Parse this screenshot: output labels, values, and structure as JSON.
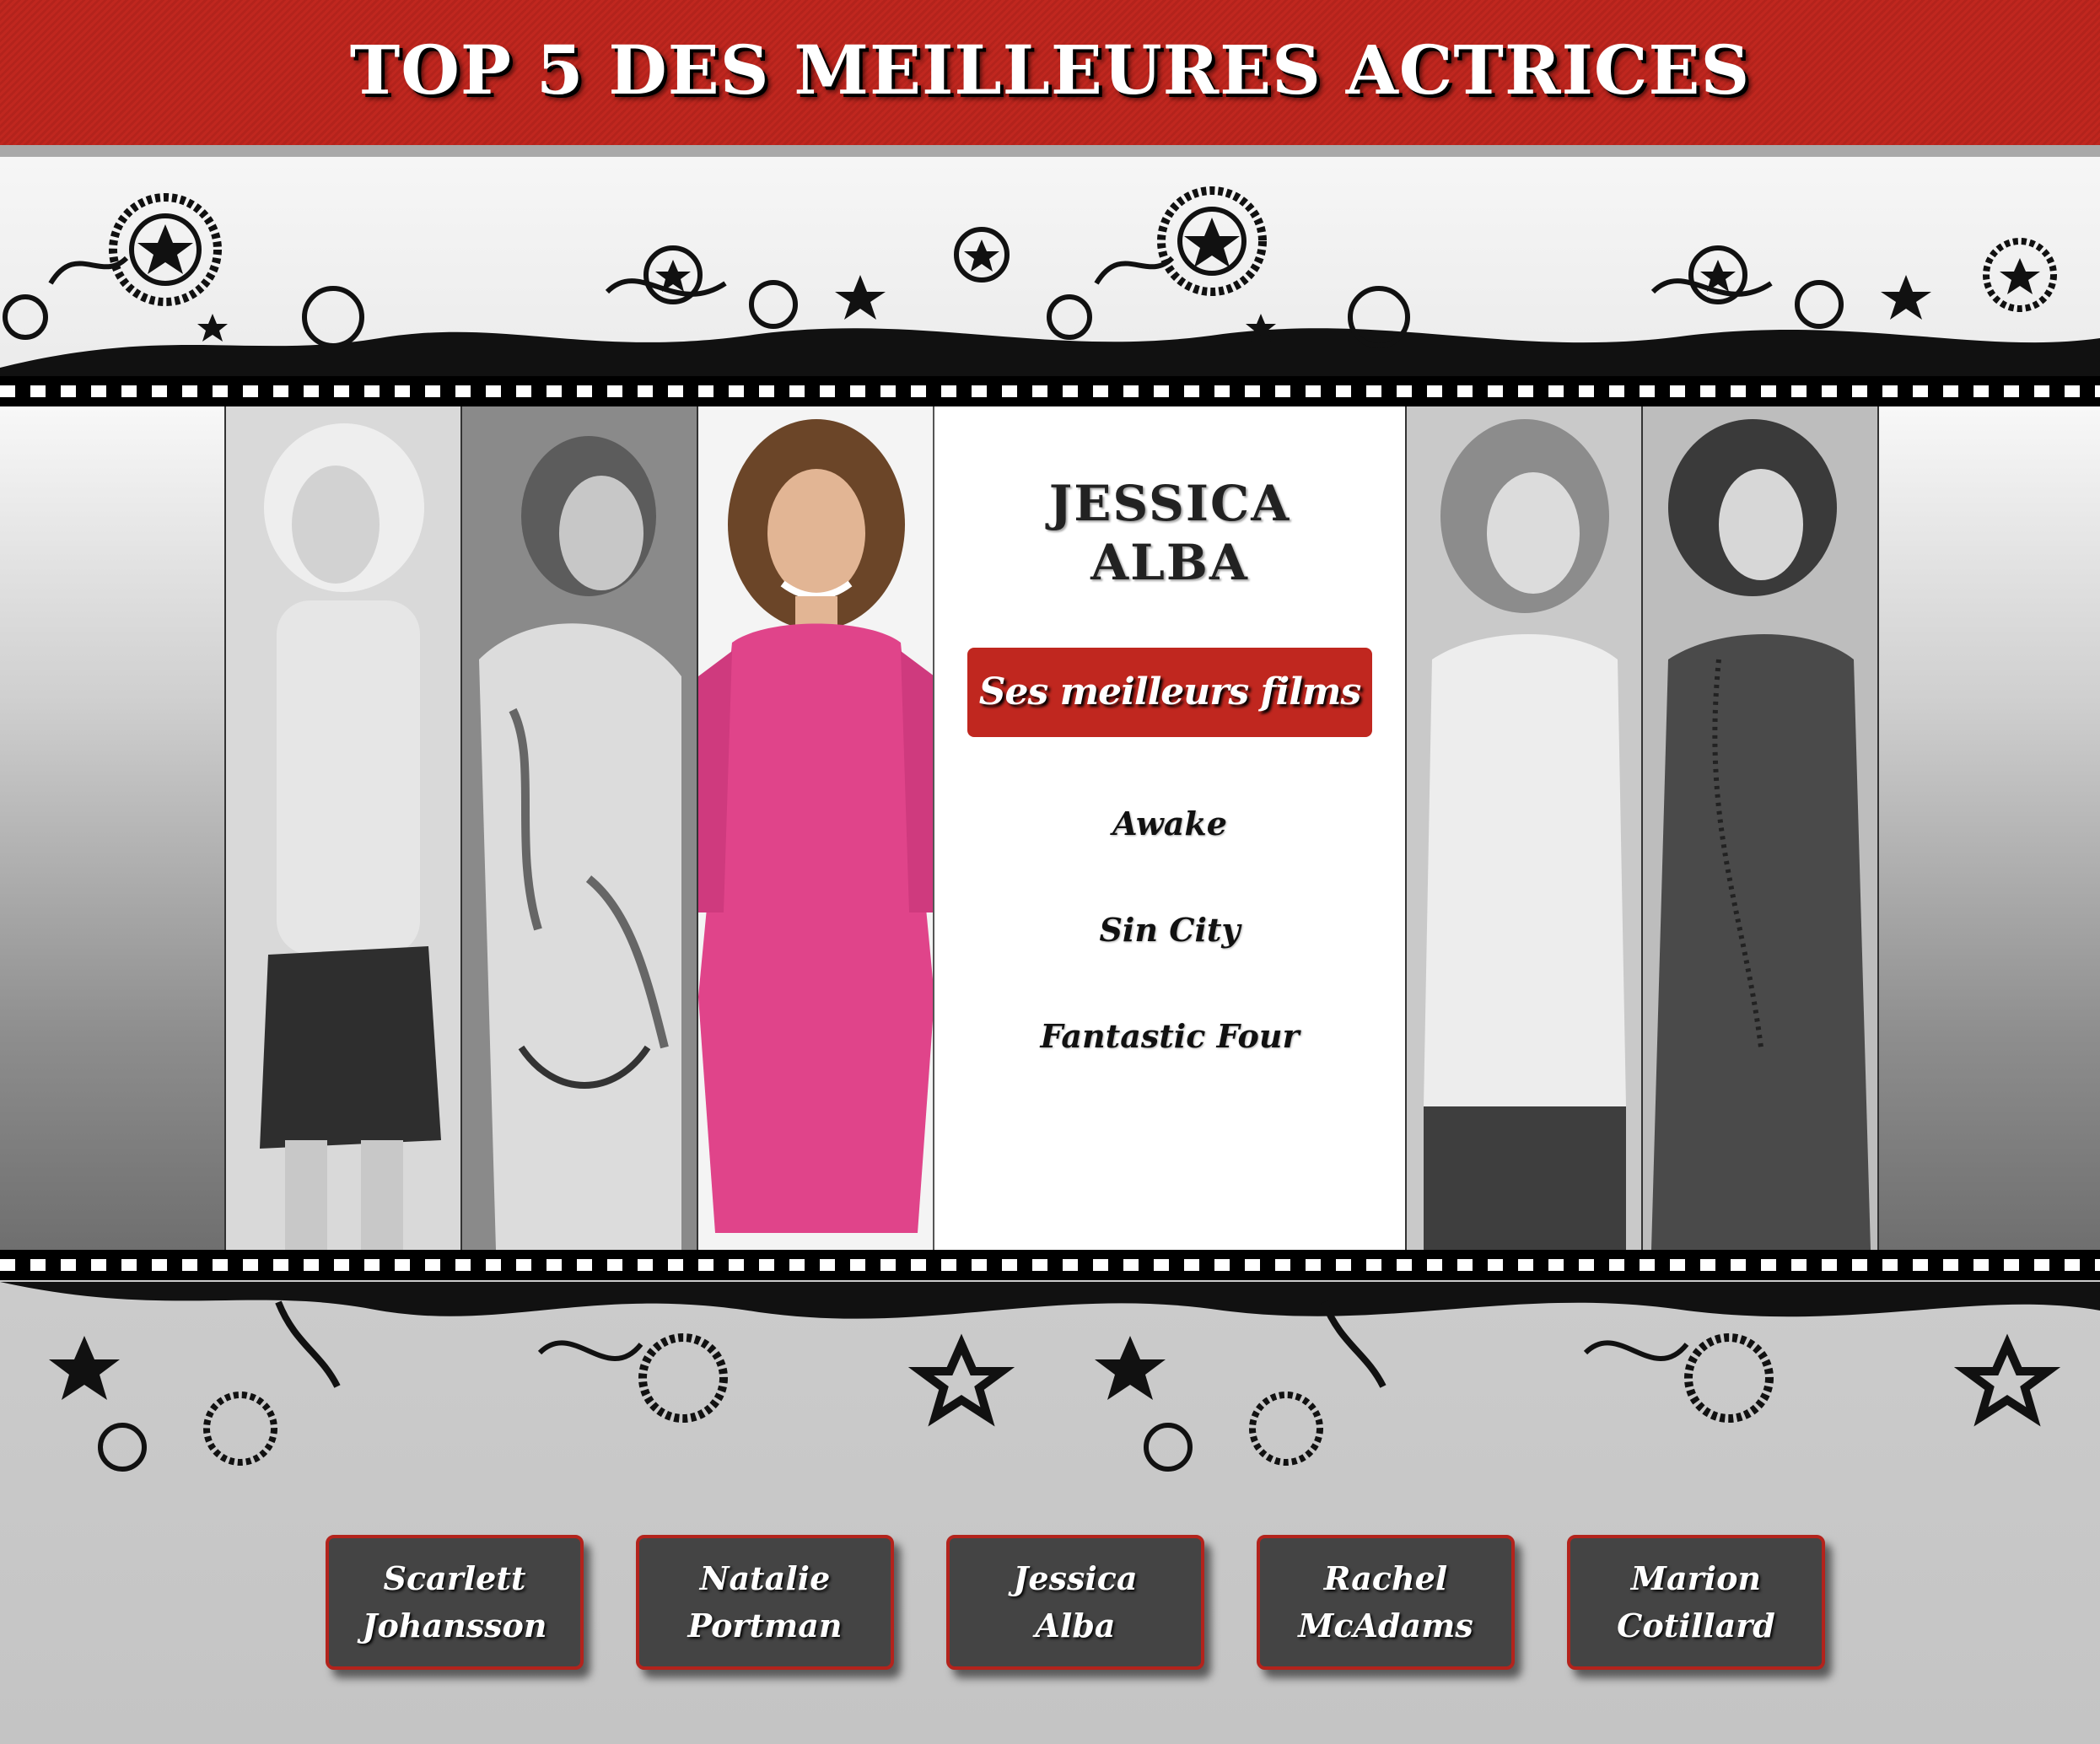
{
  "header": {
    "title": "TOP 5 DES MEILLEURES ACTRICES"
  },
  "colors": {
    "accent": "#c0271f",
    "button_bg": "#444444",
    "panel_bg": "#ffffff"
  },
  "featured": {
    "name_line1": "JESSICA",
    "name_line2": "ALBA",
    "films_label": "Ses meilleurs films",
    "films": [
      "Awake",
      "Sin City",
      "Fantastic Four"
    ]
  },
  "portraits": [
    {
      "name": "Scarlett Johansson",
      "color": false
    },
    {
      "name": "Natalie Portman",
      "color": false
    },
    {
      "name": "Jessica Alba",
      "color": true
    },
    {
      "name": "Rachel McAdams",
      "color": false
    },
    {
      "name": "Marion Cotillard",
      "color": false
    }
  ],
  "nav": {
    "items": [
      {
        "line1": "Scarlett",
        "line2": "Johansson"
      },
      {
        "line1": "Natalie",
        "line2": "Portman"
      },
      {
        "line1": "Jessica",
        "line2": "Alba"
      },
      {
        "line1": "Rachel",
        "line2": "McAdams"
      },
      {
        "line1": "Marion",
        "line2": "Cotillard"
      }
    ]
  }
}
